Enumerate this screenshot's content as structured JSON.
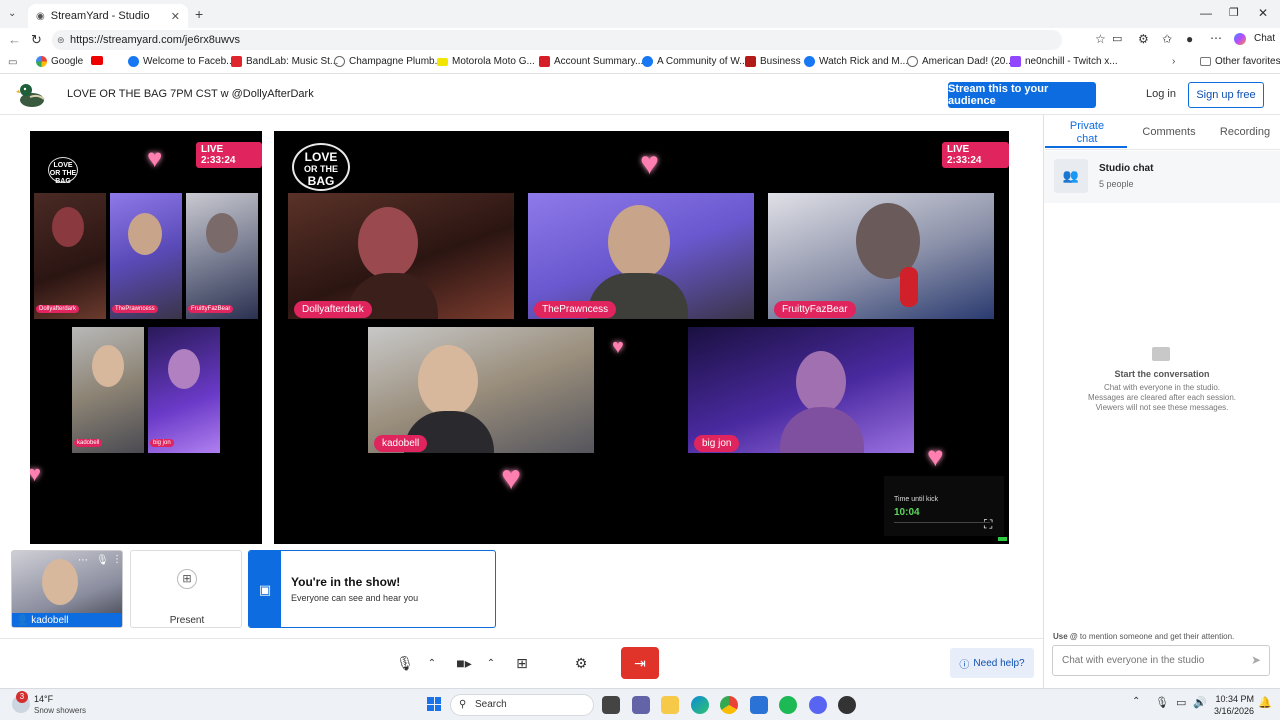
{
  "browser": {
    "tab_title": "StreamYard - Studio",
    "url": "https://streamyard.com/je6rx8uwvs",
    "chat_label": "Chat",
    "bookmarks": [
      "Google",
      "Welcome to Faceb...",
      "BandLab: Music St...",
      "Champagne Plumb...",
      "Motorola Moto G...",
      "Account Summary...",
      "A Community of W...",
      "Business",
      "Watch Rick and M...",
      "American Dad! (20...",
      "ne0nchill - Twitch x..."
    ],
    "other_favorites": "Other favorites"
  },
  "app": {
    "title": "LOVE OR THE BAG 7PM CST w @DollyAfterDark",
    "stream_button": "Stream this to your audience",
    "login": "Log in",
    "signup": "Sign up free"
  },
  "stage": {
    "live": "LIVE 2:33:24",
    "logo_lines": [
      "LOVE",
      "OR THE",
      "BAG"
    ],
    "participants": [
      "Dollyafterdark",
      "ThePrawncess",
      "FruittyFazBear",
      "kadobell",
      "big jon"
    ],
    "timer_label": "Time until kick",
    "timer_value": "10:04"
  },
  "preview": {
    "live": "LIVE 2:33:24",
    "participants": [
      "Dollyafterdark",
      "ThePrawncess",
      "FruittyFazBear",
      "kadobell",
      "big jon"
    ]
  },
  "backstage": {
    "self_name": "kadobell",
    "present_label": "Present",
    "banner_title": "You're in the show!",
    "banner_sub": "Everyone can see and hear you"
  },
  "chat": {
    "tabs": [
      "Private chat",
      "Comments",
      "Recording"
    ],
    "studio_title": "Studio chat",
    "studio_count": "5 people",
    "empty_title": "Start the conversation",
    "empty_lines": [
      "Chat with everyone in the studio.",
      "Messages are cleared after each session.",
      "Viewers will not see these messages."
    ],
    "hint": "Use @ to mention someone and get their attention.",
    "hint_bold": "Use @",
    "input_placeholder": "Chat with everyone in the studio"
  },
  "toolbar": {
    "help": "Need help?"
  },
  "taskbar": {
    "weather_temp": "14°F",
    "weather_desc": "Snow showers",
    "search": "Search",
    "time": "10:34 PM",
    "date": "3/16/2026",
    "badge": "3"
  },
  "colors": {
    "accent": "#0d6de0",
    "live": "#e0245e",
    "leave": "#e0342a",
    "timer": "#5cd65c"
  }
}
